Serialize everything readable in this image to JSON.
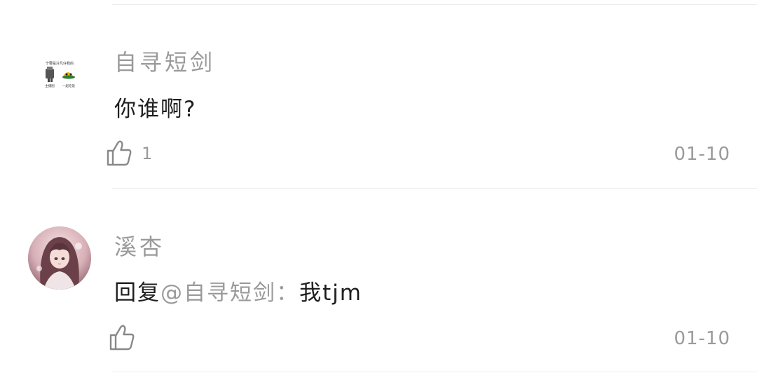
{
  "comments": [
    {
      "username": "自寻短剑",
      "text": "你谁啊?",
      "likes": "1",
      "date": "01-10",
      "avatar": "logo-avatar",
      "avatar_caption_top": "宁要是冷凡仔我的",
      "avatar_caption_left": "主播图",
      "avatar_caption_right": "一起吃饭"
    },
    {
      "username": "溪杏",
      "reply_prefix": "回复",
      "reply_mention": "@自寻短剑",
      "reply_sep": "：",
      "reply_text": "我tjm",
      "likes": "",
      "date": "01-10",
      "avatar": "anime-girl-avatar"
    }
  ],
  "icons": {
    "like": "thumbs-up-icon"
  },
  "colors": {
    "secondary_text": "#9a9a9a",
    "primary_text": "#1e1e1e",
    "divider": "#ececec"
  }
}
